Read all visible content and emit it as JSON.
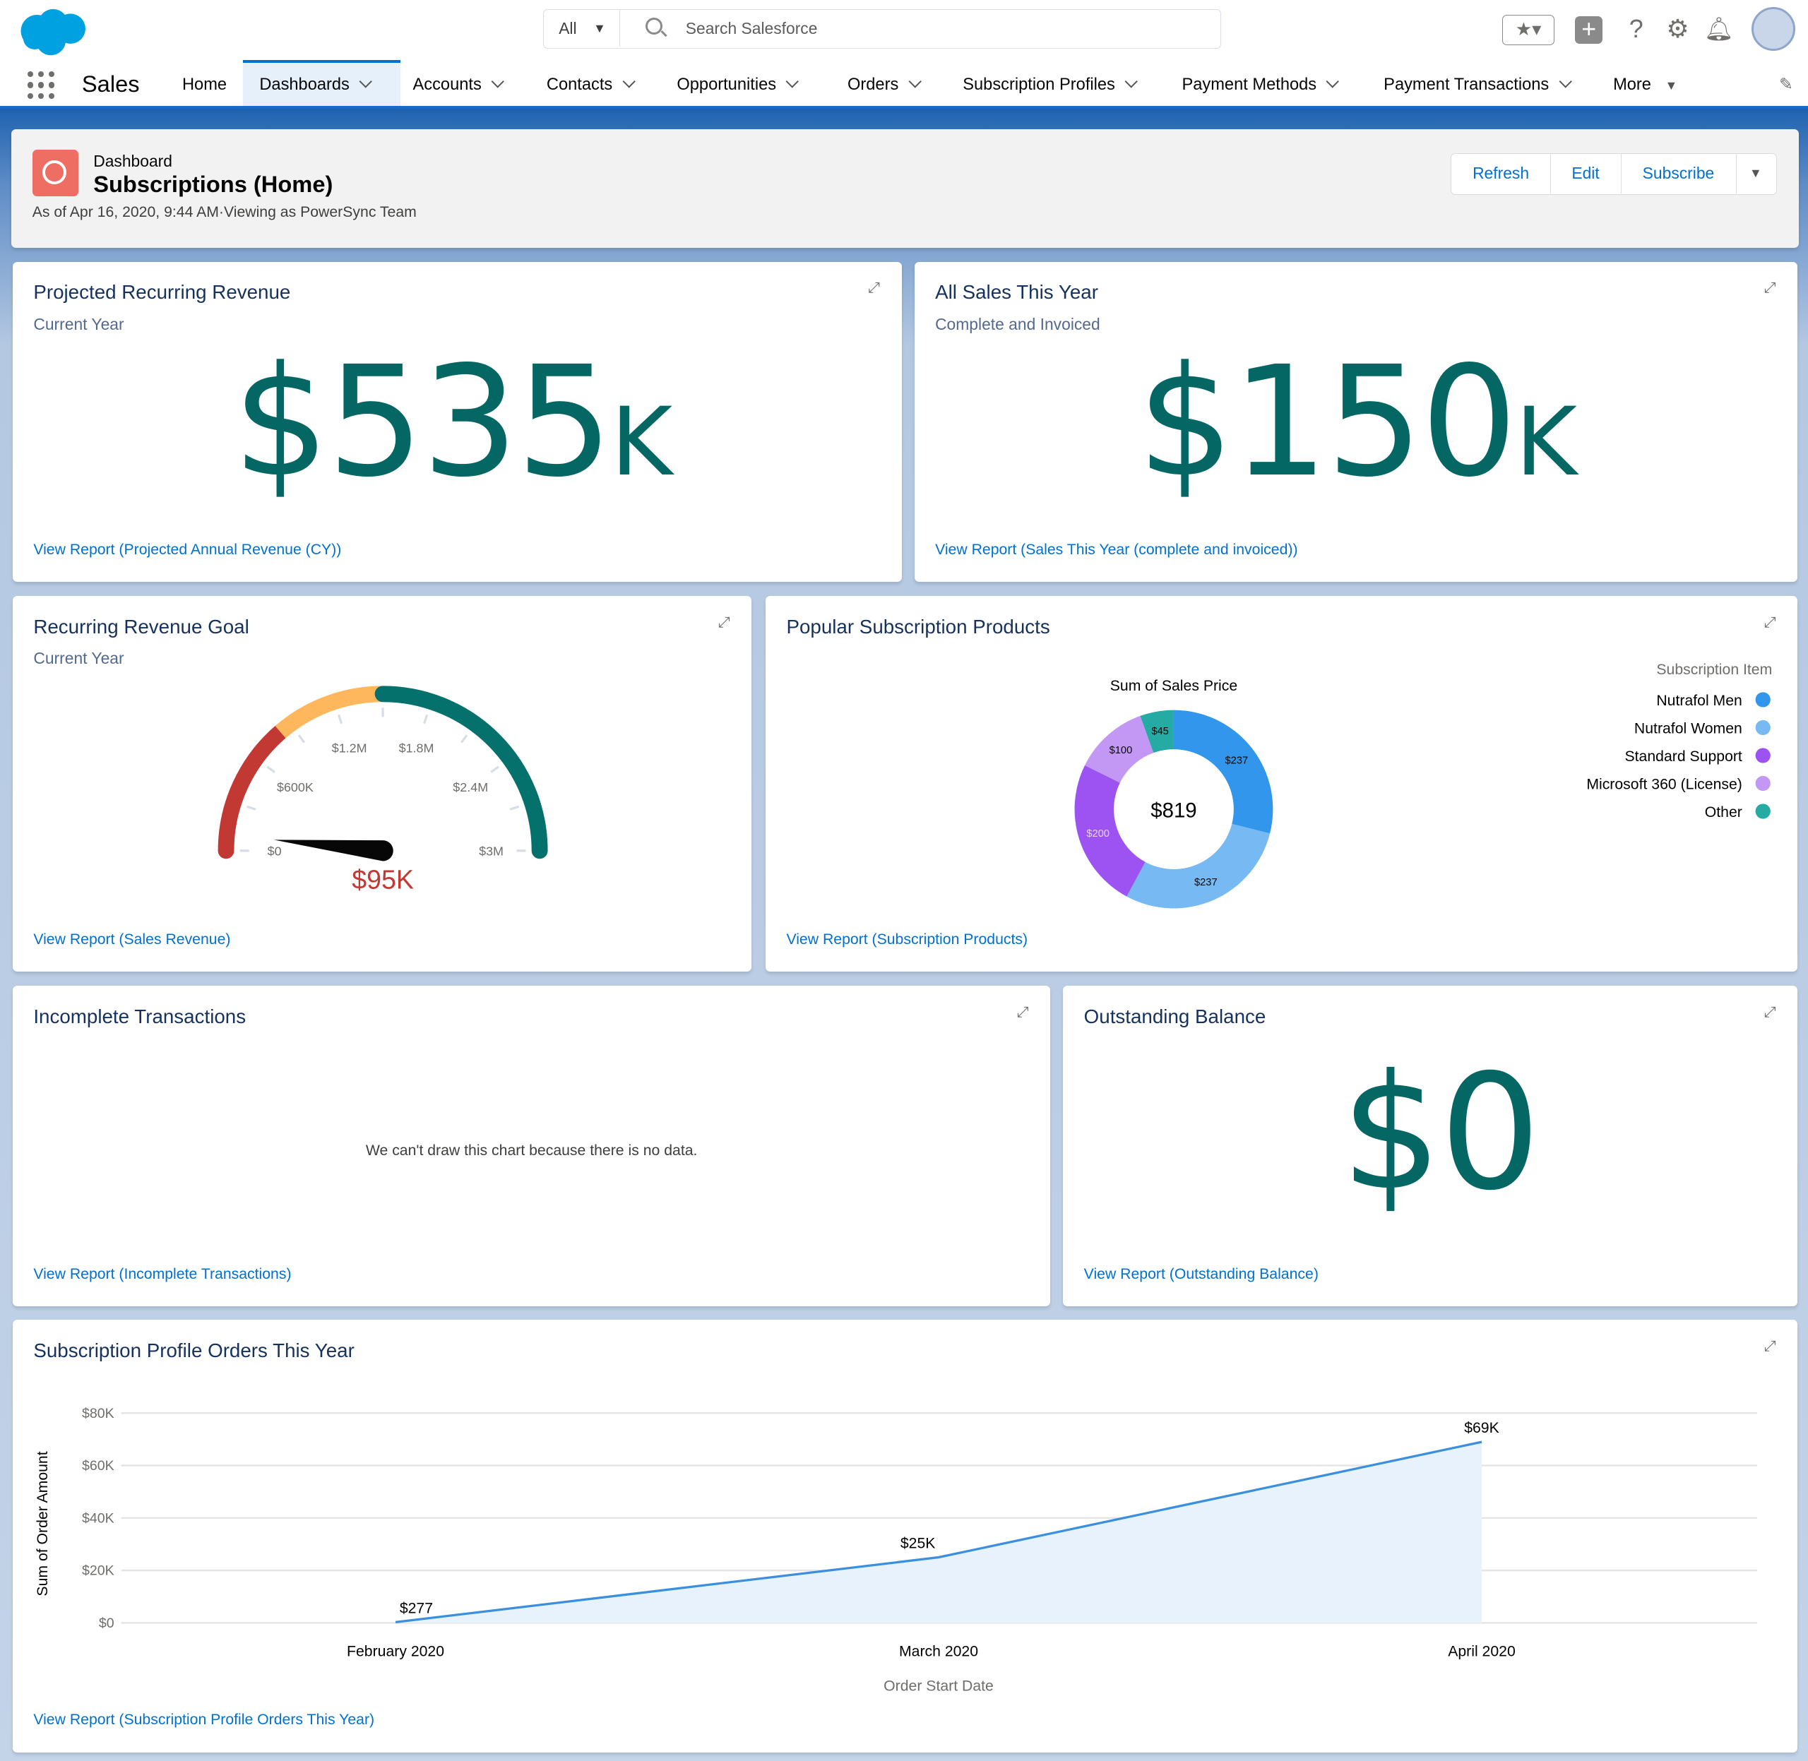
{
  "global": {
    "search_scope": "All",
    "search_placeholder": "Search Salesforce",
    "app_name": "Sales"
  },
  "nav": {
    "tabs": [
      {
        "label": "Home"
      },
      {
        "label": "Dashboards"
      },
      {
        "label": "Accounts"
      },
      {
        "label": "Contacts"
      },
      {
        "label": "Opportunities"
      },
      {
        "label": "Orders"
      },
      {
        "label": "Subscription Profiles"
      },
      {
        "label": "Payment Methods"
      },
      {
        "label": "Payment Transactions"
      },
      {
        "label": "More"
      }
    ],
    "active": "Dashboards"
  },
  "header": {
    "type": "Dashboard",
    "title": "Subscriptions (Home)",
    "meta": "As of Apr 16, 2020, 9:44 AM·Viewing as PowerSync Team",
    "buttons": {
      "refresh": "Refresh",
      "edit": "Edit",
      "subscribe": "Subscribe"
    }
  },
  "widgets": {
    "projected": {
      "title": "Projected Recurring Revenue",
      "subtitle": "Current Year",
      "value": "$535",
      "unit": "K",
      "link": "View Report (Projected Annual Revenue (CY))"
    },
    "all_sales": {
      "title": "All Sales This Year",
      "subtitle": "Complete and Invoiced",
      "value": "$150",
      "unit": "K",
      "link": "View Report (Sales This Year (complete and invoiced))"
    },
    "goal": {
      "title": "Recurring Revenue Goal",
      "subtitle": "Current Year",
      "link": "View Report (Sales Revenue)"
    },
    "popular": {
      "title": "Popular Subscription Products",
      "link": "View Report (Subscription Products)"
    },
    "incomplete": {
      "title": "Incomplete Transactions",
      "message": "We can't draw this chart because there is no data.",
      "link": "View Report (Incomplete Transactions)"
    },
    "outstanding": {
      "title": "Outstanding Balance",
      "value": "$0",
      "link": "View Report (Outstanding Balance)"
    },
    "orders": {
      "title": "Subscription Profile Orders This Year",
      "link": "View Report (Subscription Profile Orders This Year)"
    }
  },
  "chart_data": [
    {
      "type": "gauge",
      "min": 0,
      "max": 3000000,
      "value": 95000,
      "value_label": "$95K",
      "tick_labels": [
        "$0",
        "$600K",
        "$1.2M",
        "$1.8M",
        "$2.4M",
        "$3M"
      ],
      "bands": [
        {
          "to": 820000,
          "color": "#c23934"
        },
        {
          "to": 1500000,
          "color": "#ffb75d"
        },
        {
          "to": 3000000,
          "color": "#04716c"
        }
      ]
    },
    {
      "type": "pie",
      "donut": true,
      "title": "Sum of Sales Price",
      "total_label": "$819",
      "legend_title": "Subscription Item",
      "legend": "right",
      "slices": [
        {
          "name": "Nutrafol Men",
          "value": 237,
          "label": "$237",
          "color": "#3296ed"
        },
        {
          "name": "Nutrafol Women",
          "value": 237,
          "label": "$237",
          "color": "#77b9f2"
        },
        {
          "name": "Standard Support",
          "value": 200,
          "label": "$200",
          "color": "#9d53f2"
        },
        {
          "name": "Microsoft 360 (License)",
          "value": 100,
          "label": "$100",
          "color": "#c398f5"
        },
        {
          "name": "Other",
          "value": 45,
          "label": "$45",
          "color": "#26aba4"
        }
      ]
    },
    {
      "type": "area",
      "xlabel": "Order Start Date",
      "ylabel": "Sum of Order Amount",
      "ylim": [
        0,
        80000
      ],
      "grid": true,
      "categories": [
        "February 2020",
        "March 2020",
        "April 2020"
      ],
      "values": [
        277,
        25000,
        69000
      ],
      "data_labels": [
        "$277",
        "$25K",
        "$69K"
      ],
      "y_ticks": [
        {
          "v": 0,
          "label": "$0"
        },
        {
          "v": 20000,
          "label": "$20K"
        },
        {
          "v": 40000,
          "label": "$40K"
        },
        {
          "v": 60000,
          "label": "$60K"
        },
        {
          "v": 80000,
          "label": "$80K"
        }
      ],
      "color": "#3a8fe0"
    }
  ]
}
